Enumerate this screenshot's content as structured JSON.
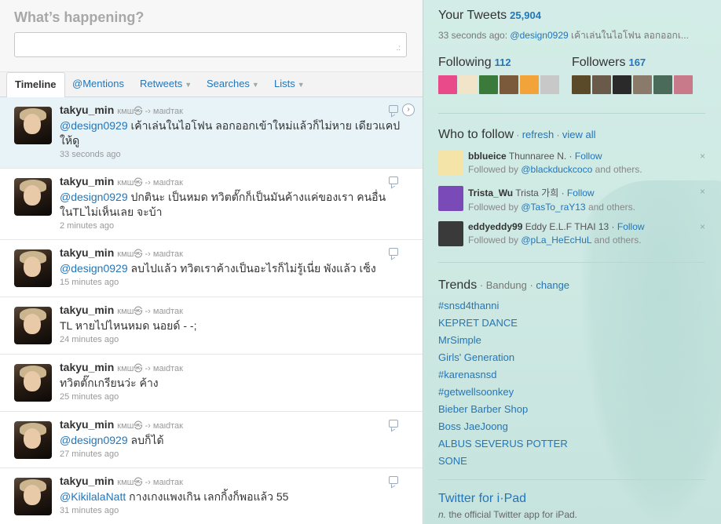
{
  "composer": {
    "prompt": "What’s happening?"
  },
  "tabs": [
    {
      "label": "Timeline",
      "active": true
    },
    {
      "label": "@Mentions"
    },
    {
      "label": "Retweets",
      "caret": true
    },
    {
      "label": "Searches",
      "caret": true
    },
    {
      "label": "Lists",
      "caret": true
    }
  ],
  "tweets": [
    {
      "name": "takyu_min",
      "full": "кмш㉿ -› маιdтак",
      "mention": "@design0929",
      "text": " เค้าเล่นในไอโฟน ลอกออกเข้าใหม่แล้วก็ไม่หาย เดียวแคปให้ดู",
      "time": "33 seconds ago"
    },
    {
      "name": "takyu_min",
      "full": "кмш㉿ -› маιdтак",
      "mention": "@design0929",
      "text": " ปกตินะ เป็นหมด ทวิตตั๊กก็เป็นมันค้างแค่ของเรา คนอื่นในTLไม่เห็นเลย จะบ้า",
      "time": "2 minutes ago"
    },
    {
      "name": "takyu_min",
      "full": "кмш㉿ -› маιdтак",
      "mention": "@design0929",
      "text": " ลบไปแล้ว ทวิตเราค้างเป็นอะไรก็ไม่รู้เนี่ย พังแล้ว เซ็ง",
      "time": "15 minutes ago"
    },
    {
      "name": "takyu_min",
      "full": "кмш㉿ -› маιdтак",
      "mention": "",
      "text": "TL หายไปไหนหมด นอยด์ - -;",
      "time": "24 minutes ago"
    },
    {
      "name": "takyu_min",
      "full": "кмш㉿ -› маιdтак",
      "mention": "",
      "text": "ทวิตตั๊กเกรียนว่ะ ค้าง",
      "time": "25 minutes ago"
    },
    {
      "name": "takyu_min",
      "full": "кмш㉿ -› маιdтак",
      "mention": "@design0929",
      "text": " ลบก็ได้",
      "time": "27 minutes ago"
    },
    {
      "name": "takyu_min",
      "full": "кмш㉿ -› маιdтак",
      "mention": "@KikilalaNatt",
      "text": " กางเกงแพงเกิน เลกกิ้งก็พอแล้ว 55",
      "time": "31 minutes ago"
    }
  ],
  "dashboard": {
    "your_tweets_label": "Your Tweets",
    "your_tweets_count": "25,904",
    "last_tweet_time": "33 seconds ago:",
    "last_tweet_mention": "@design0929",
    "last_tweet_text": " เค้าเล่นในไอโฟน ลอกออกเ...",
    "following_label": "Following",
    "following_count": "112",
    "followers_label": "Followers",
    "followers_count": "167",
    "following_thumb_colors": [
      "#e84a8a",
      "#f2e4c8",
      "#3a7a3a",
      "#7a5a3a",
      "#f2a43a",
      "#c8c8c8"
    ],
    "followers_thumb_colors": [
      "#5a4a2a",
      "#6a5a4a",
      "#2a2a2a",
      "#8a7a6a",
      "#4a6a5a",
      "#c87a8a"
    ],
    "wtf_title": "Who to follow",
    "wtf_refresh": "refresh",
    "wtf_viewall": "view all",
    "wtf": [
      {
        "username": "bblueice",
        "fullname": "Thunnaree N.",
        "follow": "Follow",
        "followed_by": "@blackduckcoco",
        "followed_suffix": " and others.",
        "prefix": "Followed by ",
        "color": "#f4e4a8"
      },
      {
        "username": "Trista_Wu",
        "fullname": "Trista 가희",
        "follow": "Follow",
        "followed_by": "@TasTo_raY13",
        "followed_suffix": " and others.",
        "prefix": "Followed by ",
        "color": "#7a4ab8"
      },
      {
        "username": "eddyeddy99",
        "fullname": "Eddy E.L.F THAI 13",
        "follow": "Follow",
        "followed_by": "@pLa_HeEcHuL",
        "followed_suffix": " and others.",
        "prefix": "Followed by ",
        "color": "#3a3a3a"
      }
    ],
    "trends_title": "Trends",
    "trends_location": "Bandung",
    "trends_change": "change",
    "trends": [
      "#snsd4thanni",
      "KEPRET DANCE",
      "MrSimple",
      "Girls' Generation",
      "#karenasnsd",
      "#getwellsoonkey",
      "Bieber Barber Shop",
      "Boss JaeJoong",
      "ALBUS SEVERUS POTTER",
      "SONE"
    ],
    "ipad_title": "Twitter for i·Pad",
    "ipad_sub_n": "n.",
    "ipad_sub": " the official Twitter app for iPad."
  }
}
